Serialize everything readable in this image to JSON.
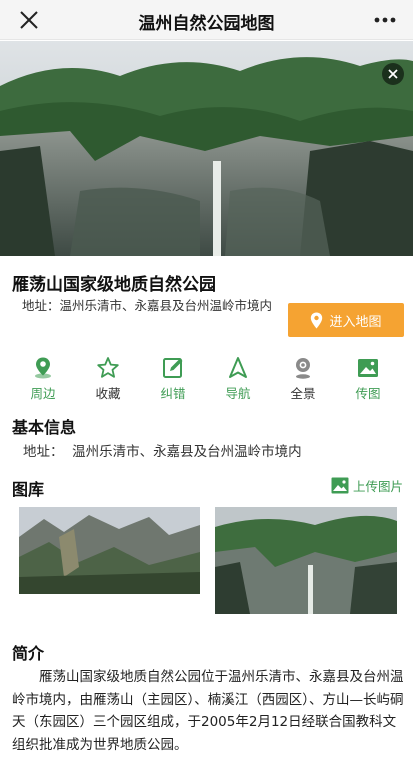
{
  "topbar": {
    "title": "温州自然公园地图",
    "close_icon": "close-icon",
    "more_icon": "more-icon"
  },
  "place": {
    "name": "雁荡山国家级地质自然公园",
    "address": "地址：温州乐清市、永嘉县及台州温岭市境内",
    "enter_button": "进入地图"
  },
  "actions": [
    {
      "label": "周边",
      "icon": "location-pin-icon",
      "color": "#3f9c54"
    },
    {
      "label": "收藏",
      "icon": "star-icon",
      "color": "#3f9c54"
    },
    {
      "label": "纠错",
      "icon": "edit-icon",
      "color": "#3f9c54"
    },
    {
      "label": "导航",
      "icon": "navigation-arrow-icon",
      "color": "#3f9c54"
    },
    {
      "label": "全景",
      "icon": "panorama-camera-icon",
      "color": "#8a8a8a"
    },
    {
      "label": "传图",
      "icon": "image-icon",
      "color": "#3f9c54"
    }
  ],
  "basic_info": {
    "heading": "基本信息",
    "address": "地址：  温州乐清市、永嘉县及台州温岭市境内"
  },
  "gallery": {
    "heading": "图库",
    "upload_label": "上传图片"
  },
  "intro": {
    "heading": "简介",
    "text": "雁荡山国家级地质自然公园位于温州乐清市、永嘉县及台州温岭市境内，由雁荡山（主园区）、楠溪江（西园区）、方山—长屿硐天（东园区）三个园区组成，于2005年2月12日经联合国教科文组织批准成为世界地质公园。"
  },
  "colors": {
    "accent_green": "#3f9c54",
    "button_orange": "#f5a332"
  }
}
